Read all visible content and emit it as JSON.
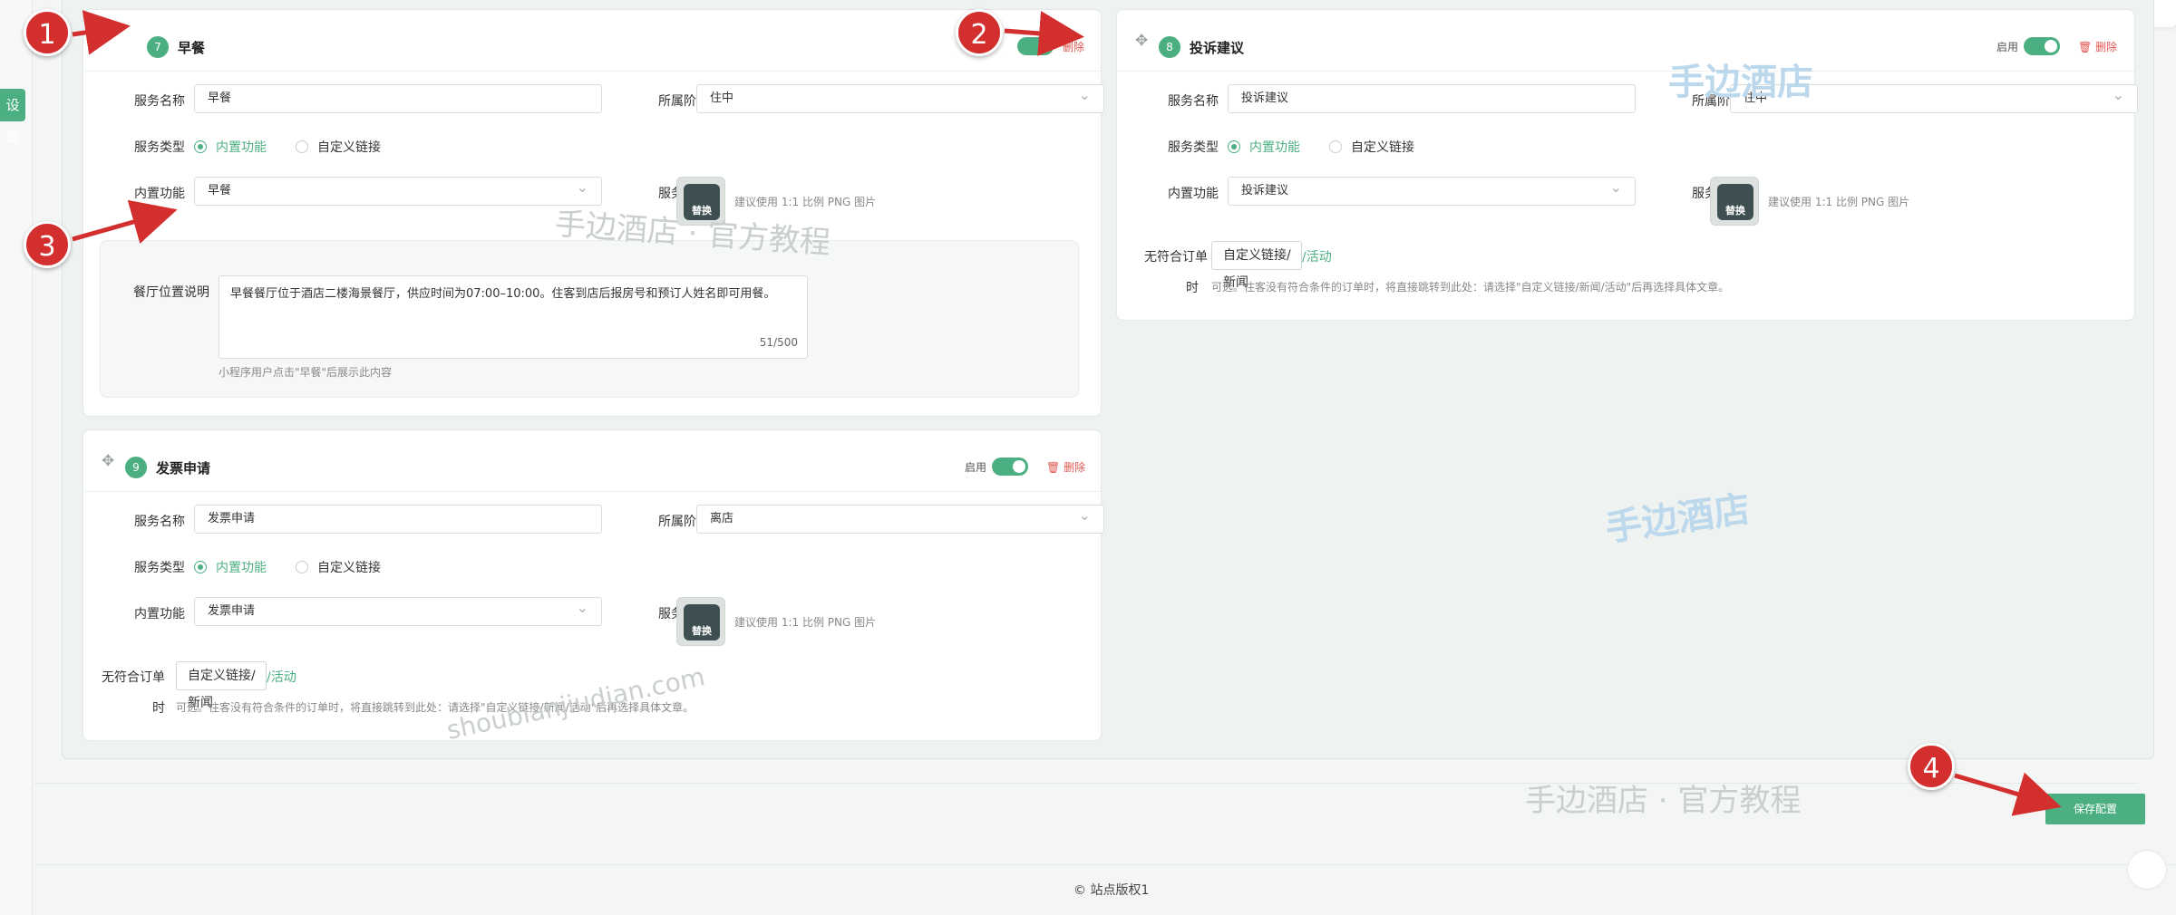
{
  "sidebar": {
    "tab_label": "设置"
  },
  "cards": {
    "breakfast": {
      "num": "7",
      "title": "早餐",
      "delete": "删除",
      "service_name_label": "服务名称",
      "service_name_value": "早餐",
      "stage_label": "所属阶段",
      "stage_value": "住中",
      "type_label": "服务类型",
      "type_builtin": "内置功能",
      "type_custom": "自定义链接",
      "builtin_label": "内置功能",
      "builtin_value": "早餐",
      "icon_label": "服务图标",
      "icon_swap": "替换",
      "icon_hint": "建议使用 1:1 比例 PNG 图片",
      "desc_label": "餐厅位置说明",
      "desc_value": "早餐餐厅位于酒店二楼海景餐厅，供应时间为07:00–10:00。住客到店后报房号和预订人姓名即可用餐。",
      "desc_count": "51/500",
      "desc_hint": "小程序用户点击\"早餐\"后展示此内容"
    },
    "complaint": {
      "num": "8",
      "title": "投诉建议",
      "enable": "启用",
      "delete": "删除",
      "service_name_label": "服务名称",
      "service_name_value": "投诉建议",
      "stage_label": "所属阶段",
      "stage_value": "住中",
      "type_label": "服务类型",
      "type_builtin": "内置功能",
      "type_custom": "自定义链接",
      "builtin_label": "内置功能",
      "builtin_value": "投诉建议",
      "icon_label": "服务图标",
      "icon_swap": "替换",
      "icon_hint": "建议使用 1:1 比例 PNG 图片",
      "no_order_label_1": "无符合订单",
      "no_order_label_2": "时",
      "no_order_btn": "自定义链接/新闻",
      "no_order_tail": "/活动",
      "no_order_hint": "可选。住客没有符合条件的订单时，将直接跳转到此处：请选择\"自定义链接/新闻/活动\"后再选择具体文章。"
    },
    "invoice": {
      "num": "9",
      "title": "发票申请",
      "enable": "启用",
      "delete": "删除",
      "service_name_label": "服务名称",
      "service_name_value": "发票申请",
      "stage_label": "所属阶段",
      "stage_value": "离店",
      "type_label": "服务类型",
      "type_builtin": "内置功能",
      "type_custom": "自定义链接",
      "builtin_label": "内置功能",
      "builtin_value": "发票申请",
      "icon_label": "服务图标",
      "icon_swap": "替换",
      "icon_hint": "建议使用 1:1 比例 PNG 图片",
      "no_order_label_1": "无符合订单",
      "no_order_label_2": "时",
      "no_order_btn": "自定义链接/新闻",
      "no_order_tail": "/活动",
      "no_order_hint": "可选。住客没有符合条件的订单时，将直接跳转到此处：请选择\"自定义链接/新闻/活动\"后再选择具体文章。"
    }
  },
  "watermarks": {
    "brand": "手边酒店",
    "official_tutorial": "手边酒店 · 官方教程",
    "url": "shoubianjiudian.com"
  },
  "footer": {
    "save_label": "保存配置",
    "copyright": "© 站点版权1"
  },
  "markers": [
    "1",
    "2",
    "3",
    "4"
  ],
  "colors": {
    "accent": "#4caf82",
    "danger": "#e0564f",
    "marker": "#d32f2f"
  }
}
